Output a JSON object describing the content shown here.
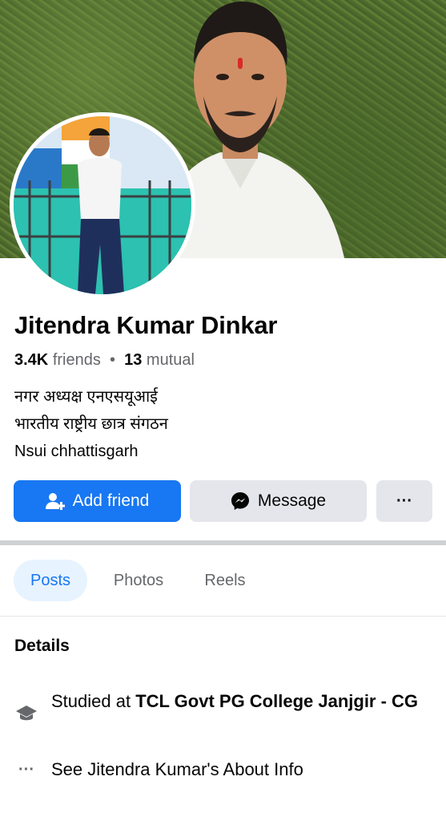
{
  "profile": {
    "name": "Jitendra Kumar Dinkar",
    "friends_count": "3.4K",
    "friends_word": "friends",
    "separator": "•",
    "mutual_count": "13",
    "mutual_word": "mutual",
    "bio_lines": [
      "नगर अध्यक्ष एनएसयूआई",
      "भारतीय राष्ट्रीय छात्र संगठन",
      "Nsui chhattisgarh"
    ]
  },
  "actions": {
    "add_friend": "Add friend",
    "message": "Message",
    "more": "···"
  },
  "tabs": [
    {
      "label": "Posts",
      "active": true
    },
    {
      "label": "Photos",
      "active": false
    },
    {
      "label": "Reels",
      "active": false
    }
  ],
  "details": {
    "title": "Details",
    "education_prefix": "Studied at ",
    "education_place": "TCL Govt PG College Janjgir - CG",
    "about_link": "See Jitendra Kumar's About Info",
    "about_icon_glyph": "···"
  },
  "colors": {
    "accent": "#1877f2",
    "button_gray": "#e4e6eb",
    "secondary_text": "#65676b",
    "active_tab_bg": "#e7f3ff"
  },
  "icons": {
    "add_friend": "person-add-icon",
    "message": "messenger-icon",
    "education": "graduation-cap-icon",
    "about": "more-dots-icon"
  }
}
